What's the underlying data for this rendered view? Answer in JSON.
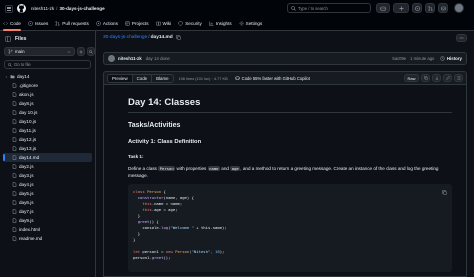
{
  "header": {
    "owner": "nitesh11-zk",
    "separator": "/",
    "repo": "30-days-js-challenge",
    "search_placeholder": "Type / to search"
  },
  "tabs": [
    {
      "label": "Code",
      "icon": "code-icon",
      "active": true
    },
    {
      "label": "Issues",
      "icon": "issue-icon",
      "active": false
    },
    {
      "label": "Pull requests",
      "icon": "pull-request-icon",
      "active": false
    },
    {
      "label": "Actions",
      "icon": "play-icon",
      "active": false
    },
    {
      "label": "Projects",
      "icon": "table-icon",
      "active": false
    },
    {
      "label": "Wiki",
      "icon": "book-icon",
      "active": false
    },
    {
      "label": "Security",
      "icon": "shield-icon",
      "active": false
    },
    {
      "label": "Insights",
      "icon": "graph-icon",
      "active": false
    },
    {
      "label": "Settings",
      "icon": "gear-icon",
      "active": false
    }
  ],
  "sidebar": {
    "title": "Files",
    "branch": "main",
    "filter_placeholder": "Go to file",
    "root": "day14",
    "files": [
      ".gitignore",
      "akon.js",
      "day8.js",
      "day 10.js",
      "day10.js",
      "day11.js",
      "day12.js",
      "day13.js",
      "day14.md",
      "day2.js",
      "day3.js",
      "day4.js",
      "day5.js",
      "day6.js",
      "day7.js",
      "day9.js",
      "index.html",
      "readme.md"
    ],
    "selected": "day14.md"
  },
  "breadcrumb": {
    "repo": "30-days-js-challenge",
    "separator": "/",
    "file": "day14.md"
  },
  "commit": {
    "author": "nitesh11-zk",
    "message": "day 14 done",
    "hash": "5ac09e",
    "time": "1 minute ago",
    "history": "History"
  },
  "file_toolbar": {
    "preview": "Preview",
    "code": "Code",
    "blame": "Blame",
    "meta": "106 lines (101 loc) · 4.77 KB",
    "copilot": "Code 55% faster with GitHub Copilot",
    "raw": "Raw"
  },
  "document": {
    "h1": "Day 14: Classes",
    "h2": "Tasks/Activities",
    "h3": "Activity 1: Class Definition",
    "h4": "Task 1:",
    "p_before1": "Define a class",
    "p_code1": "Person",
    "p_mid1": "with properties",
    "p_code2": "name",
    "p_mid2": "and",
    "p_code3": "age",
    "p_after": ", and a method to return a greeting message. Create an instance of the class and log the greeting message."
  },
  "code_block": {
    "l1_kw": "class",
    "l1_cls": "Person",
    "l1_tail": " {",
    "l2_fn": "constructor",
    "l2_tail": "(name, age) {",
    "l3_kw": "this",
    "l3_tail": ".name = name;",
    "l4_kw": "this",
    "l4_tail": ".age = age;",
    "l5": "}",
    "l6_fn": "greet",
    "l6_tail": "() {",
    "l7_a": "console.",
    "l7_fn": "log",
    "l7_str": "\"Welcome \"",
    "l7_tail": " + this.name);",
    "l8": "}",
    "l9": "}",
    "l10_kw": "let",
    "l10_a": " person1 = ",
    "l10_kw2": "new",
    "l10_cls": " Person",
    "l10_str": "(\"Nitesh\"",
    "l10_num": ", 18",
    "l10_tail": ");",
    "l11_a": "person1.",
    "l11_fn": "greet",
    "l11_tail": "();"
  },
  "colors": {
    "background": "#0d1117",
    "topbar": "#010409",
    "border": "#30363d",
    "accent_tab": "#f78166",
    "link": "#2f81f7",
    "copilot_green": "#3fb950"
  }
}
